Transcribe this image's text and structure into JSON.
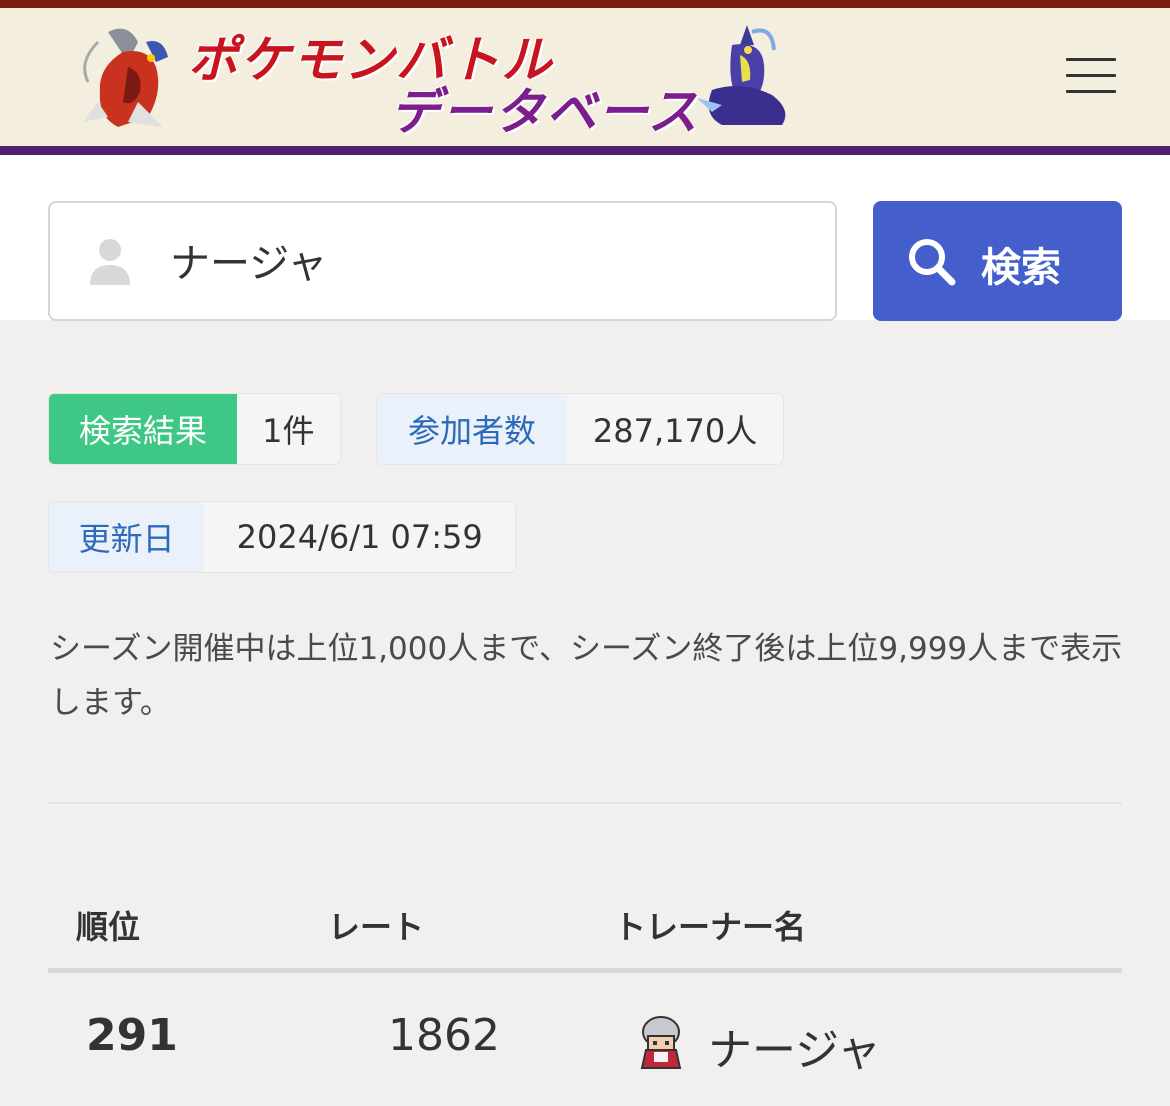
{
  "header": {
    "logo_line1": "ポケモンバトル",
    "logo_line2": "データベース"
  },
  "search": {
    "value": "ナージャ",
    "button_label": "検索"
  },
  "stats": {
    "results_label": "検索結果",
    "results_value": "1件",
    "participants_label": "参加者数",
    "participants_value": "287,170人",
    "updated_label": "更新日",
    "updated_value": "2024/6/1 07:59"
  },
  "note": "シーズン開催中は上位1,000人まで、シーズン終了後は上位9,999人まで表示します。",
  "table": {
    "columns": [
      "順位",
      "レート",
      "トレーナー名"
    ],
    "rows": [
      {
        "rank": "291",
        "rate": "1862",
        "trainer": "ナージャ",
        "avatar_icon": "trainer-sprite-icon"
      }
    ]
  },
  "colors": {
    "header_bg": "#f3eede",
    "header_top": "#7d1d12",
    "header_bottom": "#4c1f70",
    "search_button": "#445fcc",
    "results_badge": "#3fc785",
    "label_badge_text": "#2d6bb8"
  }
}
